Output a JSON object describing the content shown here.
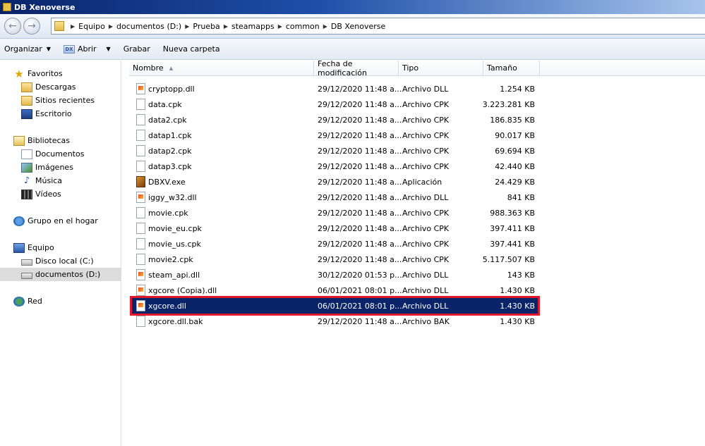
{
  "window": {
    "title": "DB Xenoverse"
  },
  "address": {
    "crumbs": [
      "Equipo",
      "documentos (D:)",
      "Prueba",
      "steamapps",
      "common",
      "DB Xenoverse"
    ]
  },
  "toolbar": {
    "organize": "Organizar",
    "open": "Abrir",
    "record": "Grabar",
    "new_folder": "Nueva carpeta"
  },
  "navpane": {
    "favorites": "Favoritos",
    "downloads": "Descargas",
    "recent": "Sitios recientes",
    "desktop": "Escritorio",
    "libraries": "Bibliotecas",
    "documents": "Documentos",
    "images": "Imágenes",
    "music": "Música",
    "videos": "Vídeos",
    "homegroup": "Grupo en el hogar",
    "computer": "Equipo",
    "local_disk": "Disco local (C:)",
    "documents_drive": "documentos (D:)",
    "network": "Red"
  },
  "columns": {
    "name": "Nombre",
    "date": "Fecha de modificación",
    "type": "Tipo",
    "size": "Tamaño"
  },
  "files": [
    {
      "name": "cryptopp.dll",
      "date": "29/12/2020 11:48 a...",
      "type": "Archivo DLL",
      "size": "1.254 KB",
      "icon": "dll"
    },
    {
      "name": "data.cpk",
      "date": "29/12/2020 11:48 a...",
      "type": "Archivo CPK",
      "size": "3.223.281 KB",
      "icon": "file"
    },
    {
      "name": "data2.cpk",
      "date": "29/12/2020 11:48 a...",
      "type": "Archivo CPK",
      "size": "186.835 KB",
      "icon": "file"
    },
    {
      "name": "datap1.cpk",
      "date": "29/12/2020 11:48 a...",
      "type": "Archivo CPK",
      "size": "90.017 KB",
      "icon": "file"
    },
    {
      "name": "datap2.cpk",
      "date": "29/12/2020 11:48 a...",
      "type": "Archivo CPK",
      "size": "69.694 KB",
      "icon": "file"
    },
    {
      "name": "datap3.cpk",
      "date": "29/12/2020 11:48 a...",
      "type": "Archivo CPK",
      "size": "42.440 KB",
      "icon": "file"
    },
    {
      "name": "DBXV.exe",
      "date": "29/12/2020 11:48 a...",
      "type": "Aplicación",
      "size": "24.429 KB",
      "icon": "exe"
    },
    {
      "name": "iggy_w32.dll",
      "date": "29/12/2020 11:48 a...",
      "type": "Archivo DLL",
      "size": "841 KB",
      "icon": "dll"
    },
    {
      "name": "movie.cpk",
      "date": "29/12/2020 11:48 a...",
      "type": "Archivo CPK",
      "size": "988.363 KB",
      "icon": "file"
    },
    {
      "name": "movie_eu.cpk",
      "date": "29/12/2020 11:48 a...",
      "type": "Archivo CPK",
      "size": "397.411 KB",
      "icon": "file"
    },
    {
      "name": "movie_us.cpk",
      "date": "29/12/2020 11:48 a...",
      "type": "Archivo CPK",
      "size": "397.441 KB",
      "icon": "file"
    },
    {
      "name": "movie2.cpk",
      "date": "29/12/2020 11:48 a...",
      "type": "Archivo CPK",
      "size": "5.117.507 KB",
      "icon": "file"
    },
    {
      "name": "steam_api.dll",
      "date": "30/12/2020 01:53 p...",
      "type": "Archivo DLL",
      "size": "143 KB",
      "icon": "dll"
    },
    {
      "name": "xgcore (Copia).dll",
      "date": "06/01/2021 08:01 p...",
      "type": "Archivo DLL",
      "size": "1.430 KB",
      "icon": "dll"
    },
    {
      "name": "xgcore.dll",
      "date": "06/01/2021 08:01 p...",
      "type": "Archivo DLL",
      "size": "1.430 KB",
      "icon": "dll",
      "selected": true
    },
    {
      "name": "xgcore.dll.bak",
      "date": "29/12/2020 11:48 a...",
      "type": "Archivo BAK",
      "size": "1.430 KB",
      "icon": "file"
    }
  ]
}
